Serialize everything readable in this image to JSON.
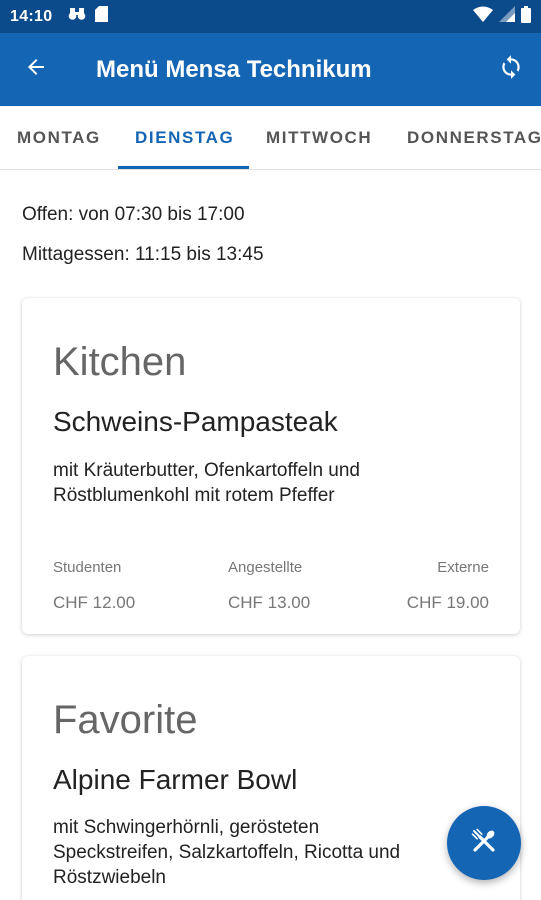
{
  "status_bar": {
    "time": "14:10",
    "icons_left": [
      "binoculars-icon",
      "sim-card-icon"
    ],
    "icons_right": [
      "wifi-icon",
      "signal-icon",
      "battery-icon"
    ]
  },
  "app_bar": {
    "title": "Menü Mensa Technikum",
    "back_icon": "arrow-left-icon",
    "refresh_icon": "refresh-icon"
  },
  "tabs": [
    {
      "label": "MONTAG",
      "active": false
    },
    {
      "label": "DIENSTAG",
      "active": true
    },
    {
      "label": "MITTWOCH",
      "active": false
    },
    {
      "label": "DONNERSTAG",
      "active": false
    }
  ],
  "info": {
    "open_hours": "Offen: von 07:30 bis 17:00",
    "lunch_hours": "Mittagessen: 11:15 bis 13:45"
  },
  "menu_cards": [
    {
      "category": "Kitchen",
      "dish": "Schweins-Pampasteak",
      "description_lines": [
        "mit Kräuterbutter, Ofenkartoffeln und",
        "Röstblumenkohl mit rotem Pfeffer"
      ],
      "prices": [
        {
          "label": "Studenten",
          "value": "CHF 12.00"
        },
        {
          "label": "Angestellte",
          "value": "CHF 13.00"
        },
        {
          "label": "Externe",
          "value": "CHF 19.00"
        }
      ]
    },
    {
      "category": "Favorite",
      "dish": "Alpine Farmer Bowl",
      "description_lines": [
        "mit Schwingerhörnli, gerösteten",
        "Speckstreifen, Salzkartoffeln, Ricotta und",
        "Röstzwiebeln"
      ]
    }
  ],
  "fab": {
    "icon": "cutlery-icon"
  },
  "colors": {
    "primary": "#1565b5",
    "status_bar": "#0b4a8b",
    "tab_inactive": "#555555"
  }
}
